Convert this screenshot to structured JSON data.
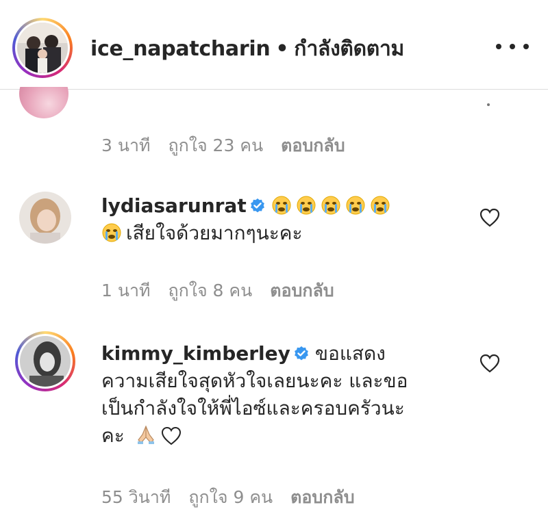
{
  "header": {
    "username": "ice_napatcharin",
    "separator": "•",
    "follow_status": "กำลังติดตาม",
    "more_icon": "more-horizontal-icon"
  },
  "comments": [
    {
      "partial": true,
      "time": "3 นาที",
      "likes": "ถูกใจ 23 คน",
      "reply": "ตอบกลับ"
    },
    {
      "username": "lydiasarunrat",
      "verified": true,
      "text_emoji_prefix_count": 5,
      "text_line2": "เสียใจด้วยมากๆนะคะ",
      "time": "1 นาที",
      "likes": "ถูกใจ 8 คน",
      "reply": "ตอบกลับ"
    },
    {
      "username": "kimmy_kimberley",
      "verified": true,
      "text_first": "ขอแสดง",
      "text_line2": "ความเสียใจสุดหัวใจเลยนะคะ และขอ",
      "text_line3": "เป็นกำลังใจให้พี่ไอซ์และครอบครัวนะ",
      "text_line4": "คะ",
      "time": "55 วินาที",
      "likes": "ถูกใจ 9 คน",
      "reply": "ตอบกลับ"
    }
  ],
  "colors": {
    "text": "#262626",
    "meta": "#8e8e8e",
    "verified": "#3897f0",
    "divider": "#dbdbdb"
  }
}
